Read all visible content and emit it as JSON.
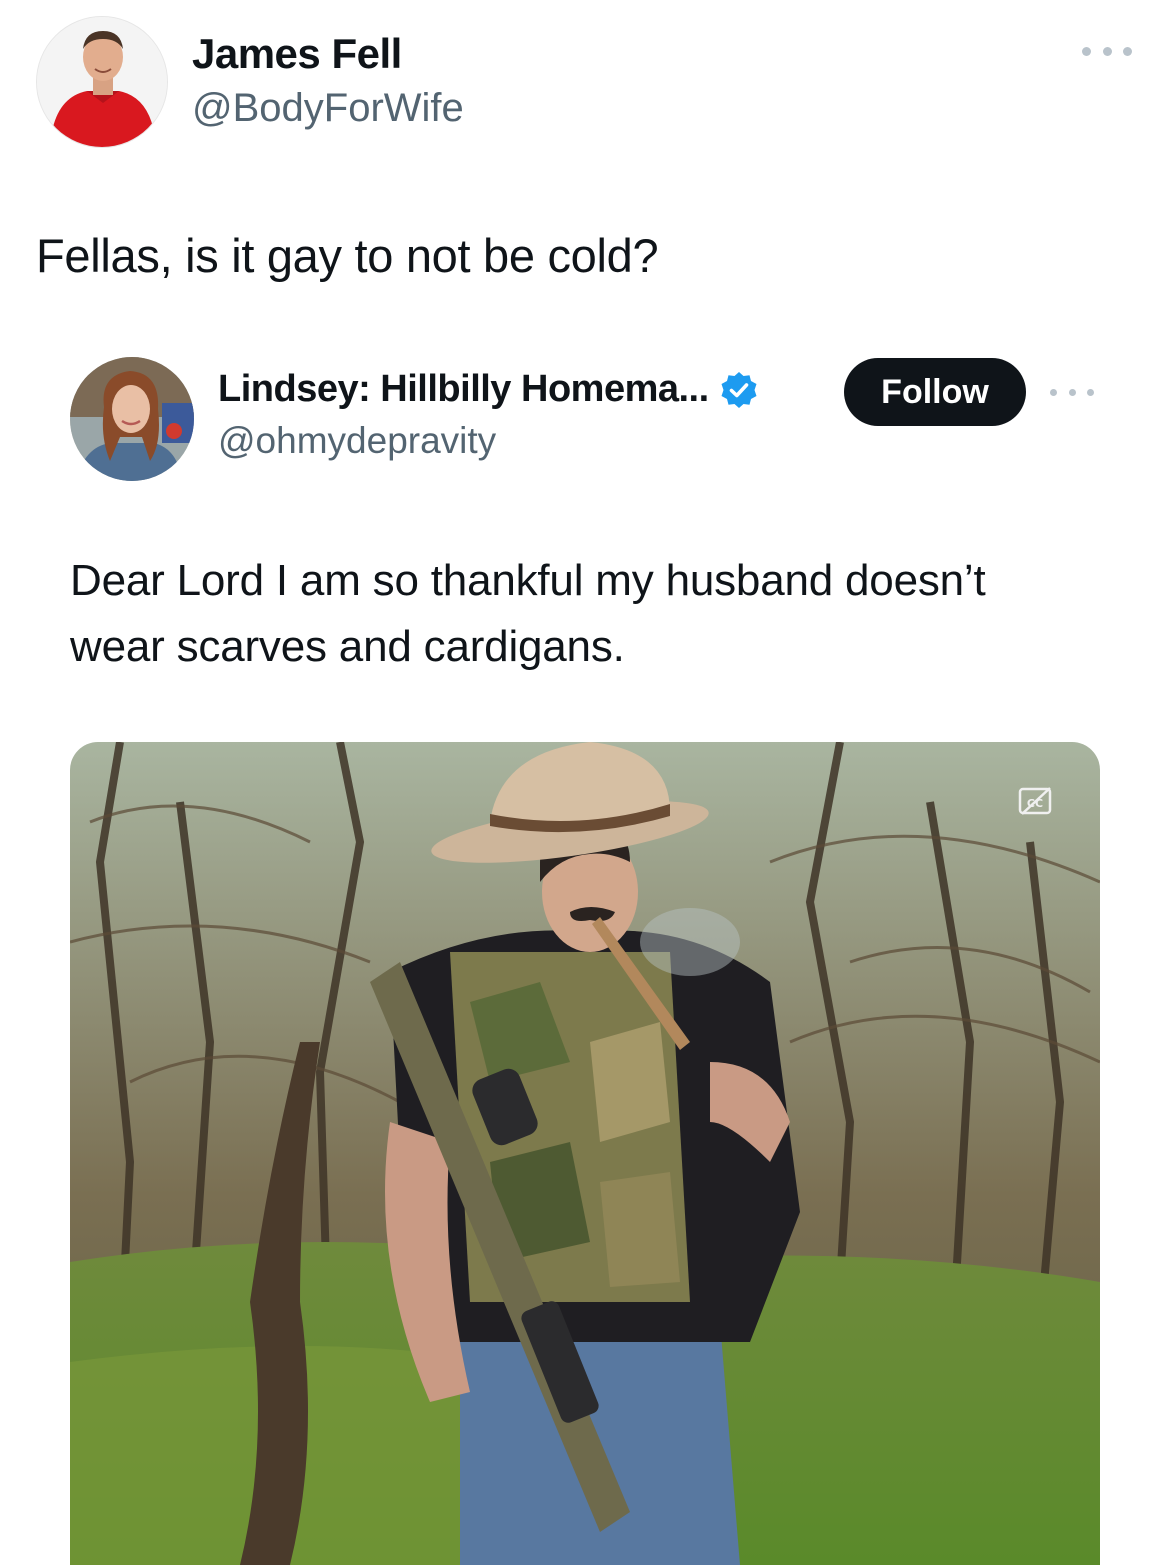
{
  "outer_tweet": {
    "author_name": "James Fell",
    "author_handle": "@BodyForWife",
    "text": "Fellas, is it gay to not be cold?",
    "avatar_icon": "profile-photo-man-red-shirt"
  },
  "quoted_tweet": {
    "author_name": "Lindsey: Hillbilly Homema...",
    "author_handle": "@ohmydepravity",
    "follow_label": "Follow",
    "text_lines": [
      "Dear Lord I am so thankful my husband doesn’t",
      "wear scarves and cardigans."
    ],
    "avatar_icon": "profile-photo-woman",
    "verified_icon": "verified-badge-icon",
    "media_icon": "closed-captions-icon"
  },
  "colors": {
    "text_primary": "#0f1419",
    "text_secondary": "#536471",
    "verified_blue": "#1d9bf0",
    "follow_bg": "#0f1419",
    "follow_text": "#ffffff"
  }
}
